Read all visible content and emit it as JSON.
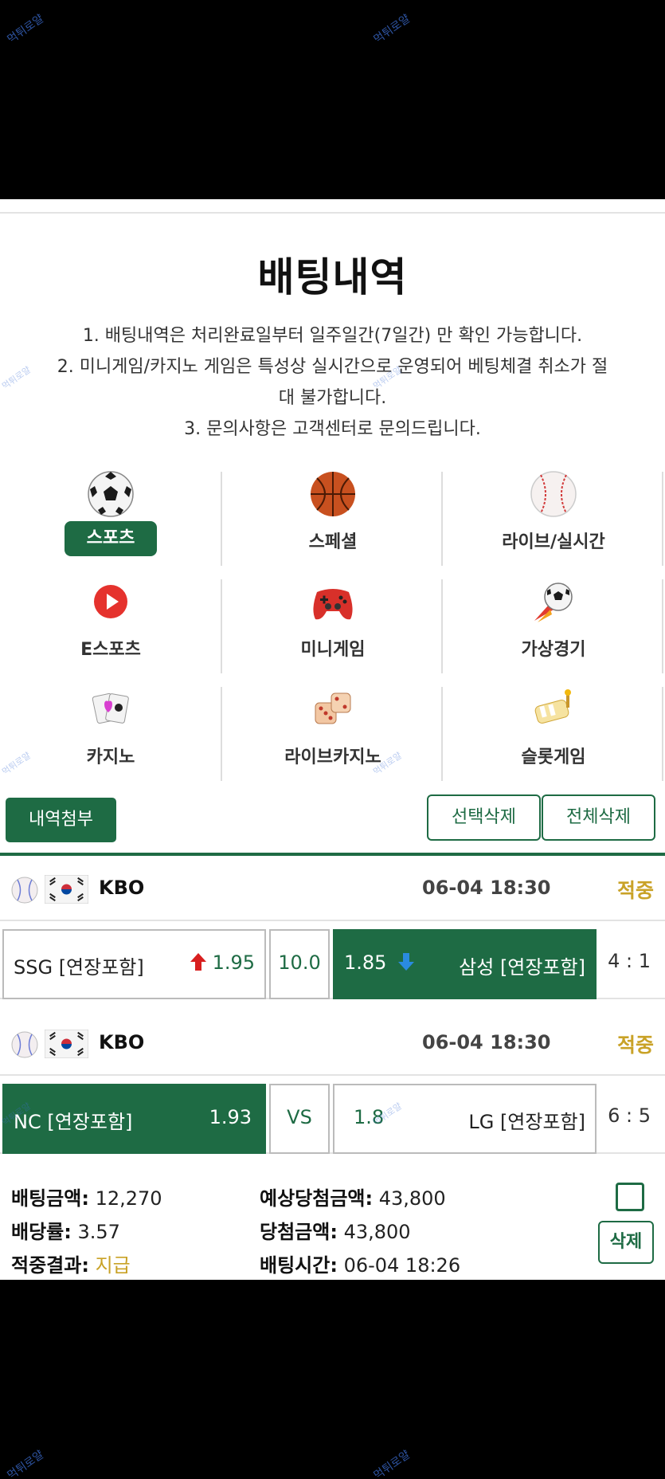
{
  "watermark": "먹튀로얄",
  "page": {
    "title": "배팅내역",
    "notices": [
      "1. 배팅내역은 처리완료일부터 일주일간(7일간) 만 확인 가능합니다.",
      "2. 미니게임/카지노 게임은 특성상 실시간으로 운영되어 베팅체결 취소가 절",
      "대 불가합니다.",
      "3. 문의사항은 고객센터로 문의드립니다."
    ]
  },
  "categories": [
    {
      "label": "스포츠",
      "icon": "soccer-ball-icon",
      "active": true
    },
    {
      "label": "스페셜",
      "icon": "basketball-icon",
      "active": false
    },
    {
      "label": "라이브/실시간",
      "icon": "baseball-icon",
      "active": false
    },
    {
      "label": "E스포츠",
      "icon": "play-button-icon",
      "active": false
    },
    {
      "label": "미니게임",
      "icon": "gamepad-icon",
      "active": false
    },
    {
      "label": "가상경기",
      "icon": "virtual-soccer-icon",
      "active": false
    },
    {
      "label": "카지노",
      "icon": "cards-icon",
      "active": false
    },
    {
      "label": "라이브카지노",
      "icon": "dice-icon",
      "active": false
    },
    {
      "label": "슬롯게임",
      "icon": "slot-icon",
      "active": false
    }
  ],
  "actions": {
    "attach": "내역첨부",
    "delete_selected": "선택삭제",
    "delete_all": "전체삭제"
  },
  "matches": [
    {
      "league": "KBO",
      "time": "06-04 18:30",
      "status": "적중",
      "home_team": "SSG [연장포함]",
      "home_odds": "1.95",
      "middle": "10.0",
      "away_odds": "1.85",
      "away_team": "삼성 [연장포함]",
      "score": "4 : 1"
    },
    {
      "league": "KBO",
      "time": "06-04 18:30",
      "status": "적중",
      "home_team": "NC [연장포함]",
      "home_odds": "1.93",
      "middle": "VS",
      "away_odds": "1.8",
      "away_team": "LG [연장포함]",
      "score": "6 : 5"
    }
  ],
  "summary": {
    "bet_amount_label": "배팅금액:",
    "bet_amount": "12,270",
    "odds_label": "배당률:",
    "odds": "3.57",
    "result_label": "적중결과:",
    "result": "지급",
    "expected_label": "예상당첨금액:",
    "expected": "43,800",
    "win_label": "당첨금액:",
    "win": "43,800",
    "bet_time_label": "배팅시간:",
    "bet_time": "06-04 18:26",
    "delete_label": "삭제"
  },
  "colors": {
    "brand_green": "#1e6b44",
    "gold": "#c9a227",
    "up_arrow": "#d81f1f",
    "down_arrow": "#2a8be0"
  }
}
